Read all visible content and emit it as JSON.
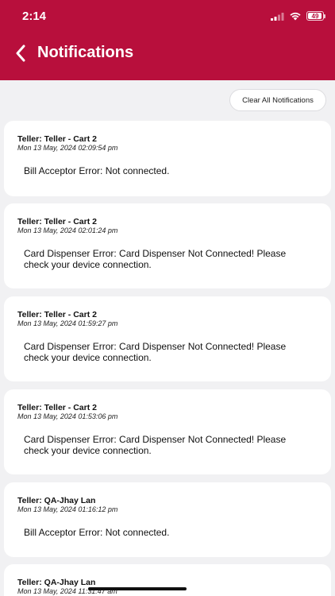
{
  "status_bar": {
    "time": "2:14",
    "battery_level": "49"
  },
  "header": {
    "title": "Notifications",
    "background_color": "#b80f3c"
  },
  "actions": {
    "clear_all_label": "Clear All Notifications"
  },
  "notifications": [
    {
      "title": "Teller: Teller - Cart 2",
      "time": "Mon 13 May, 2024 02:09:54 pm",
      "message": "Bill Acceptor Error: Not connected."
    },
    {
      "title": "Teller: Teller - Cart 2",
      "time": "Mon 13 May, 2024 02:01:24 pm",
      "message": "Card Dispenser Error: Card Dispenser Not Connected! Please check your device connection."
    },
    {
      "title": "Teller: Teller - Cart 2",
      "time": "Mon 13 May, 2024 01:59:27 pm",
      "message": "Card Dispenser Error: Card Dispenser Not Connected! Please check your device connection."
    },
    {
      "title": "Teller: Teller - Cart 2",
      "time": "Mon 13 May, 2024 01:53:06 pm",
      "message": "Card Dispenser Error: Card Dispenser Not Connected! Please check your device connection."
    },
    {
      "title": "Teller: QA-Jhay Lan",
      "time": "Mon 13 May, 2024 01:16:12 pm",
      "message": "Bill Acceptor Error: Not connected."
    },
    {
      "title": "Teller: QA-Jhay Lan",
      "time": "Mon 13 May, 2024 11:31:47 am",
      "message": ""
    }
  ]
}
